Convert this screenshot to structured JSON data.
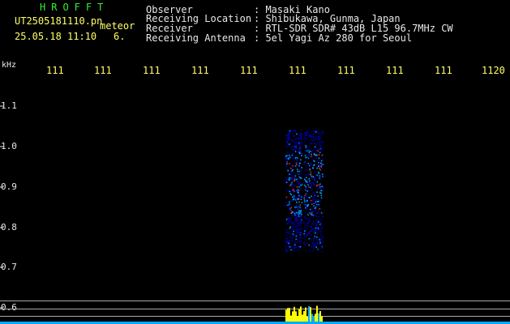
{
  "header": {
    "app_name": "HROFFT",
    "filename": "UT2505181110.pn",
    "tag": "meteor",
    "datetime": "25.05.18 11:10",
    "count": "6."
  },
  "info": [
    {
      "label": "Observer",
      "value": ": Masaki Kano"
    },
    {
      "label": "Receiving Location",
      "value": ": Shibukawa, Gunma, Japan"
    },
    {
      "label": "Receiver",
      "value": ": RTL-SDR SDR# 43dB L15 96.7MHz CW"
    },
    {
      "label": "Receiving Antenna",
      "value": ": 5el Yagi Az 280 for Seoul"
    }
  ],
  "frequency_axis": {
    "unit": "kHz",
    "time_ticks": [
      "111",
      "111",
      "111",
      "111",
      "111",
      "111",
      "111",
      "111",
      "111",
      "1120"
    ]
  },
  "y_axis": {
    "ticks": [
      "1.1",
      "1.0",
      "0.9",
      "0.8",
      "0.7",
      "0.6"
    ]
  },
  "colors": {
    "background": "#000000",
    "header_green": "#33ee33",
    "tick_yellow": "#ffff66",
    "label_white": "#e8e8e8",
    "echo_low": "#0000aa",
    "echo_mid": "#00aaff",
    "echo_high": "#ff3300",
    "level_bar": "#ffff00",
    "baseline": "#00aaff"
  }
}
